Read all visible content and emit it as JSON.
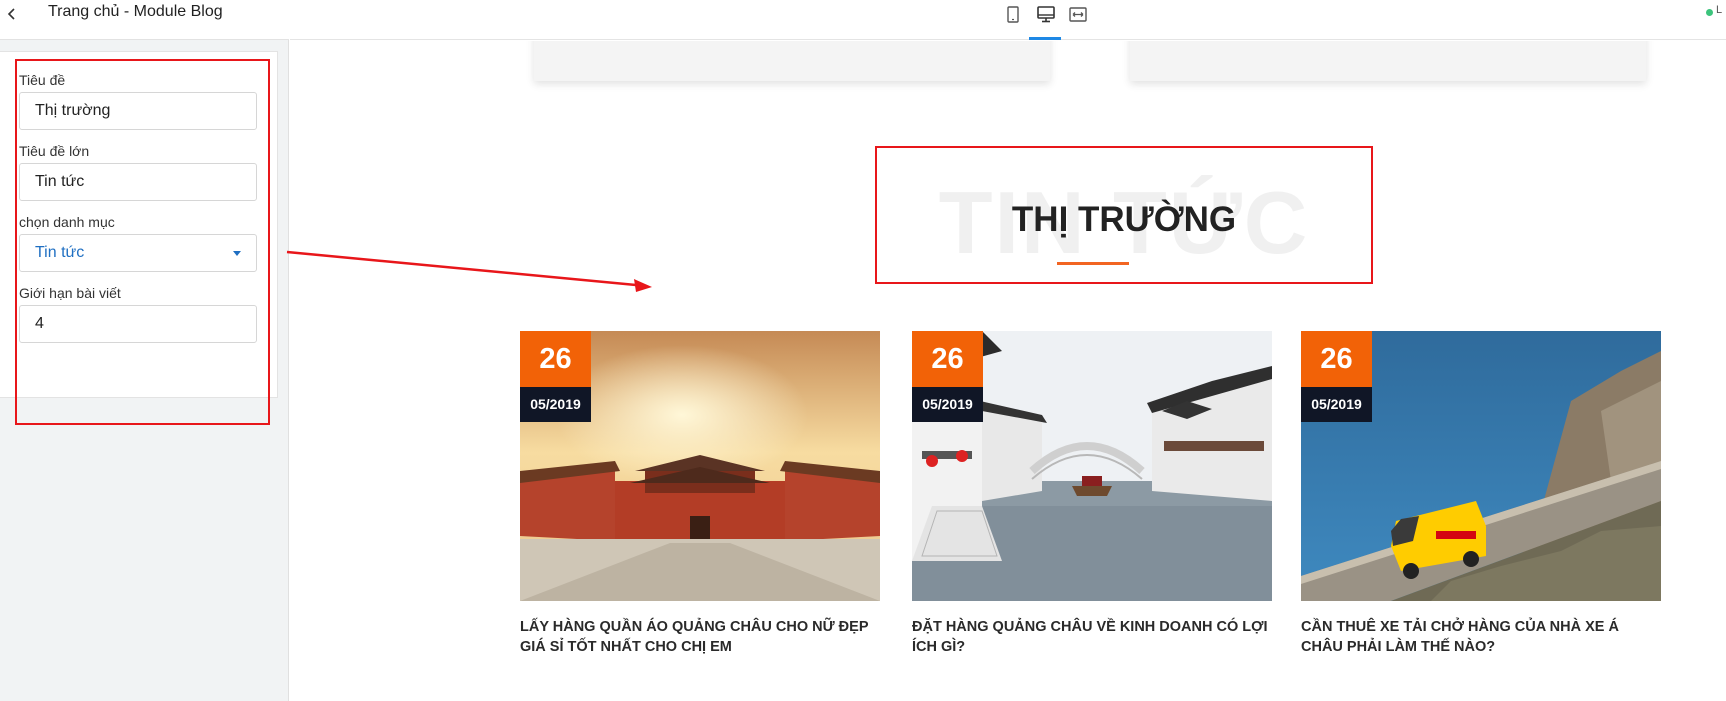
{
  "panel": {
    "title": "Trang chủ - Module Blog",
    "back_icon": "chevron-left-icon"
  },
  "form": {
    "fields": [
      {
        "label": "Tiêu đề",
        "value": "Thị trường"
      },
      {
        "label": "Tiêu đề lớn",
        "value": "Tin tức"
      },
      {
        "label": "chọn danh mục",
        "value": "Tin tức"
      },
      {
        "label": "Giới hạn bài viết",
        "value": "4"
      }
    ]
  },
  "toolbar": {
    "devices": [
      "tablet-icon",
      "desktop-icon",
      "fullwidth-icon"
    ],
    "active_device": "desktop-icon",
    "status_text": "L",
    "status_color": "#3cc47c"
  },
  "section": {
    "background_title": "TIN TỨC",
    "title": "THỊ TRƯỜNG",
    "accent_color": "#f26522"
  },
  "highlight_color": "#e8161a",
  "posts": [
    {
      "day": "26",
      "month": "05/2019",
      "title": "LẤY HÀNG QUẦN ÁO QUẢNG CHÂU CHO NỮ ĐẸP GIÁ SỈ TỐT NHẤT CHO CHỊ EM"
    },
    {
      "day": "26",
      "month": "05/2019",
      "title": "ĐẶT HÀNG QUẢNG CHÂU VỀ KINH DOANH CÓ LỢI ÍCH GÌ?"
    },
    {
      "day": "26",
      "month": "05/2019",
      "title": "CẦN THUÊ XE TẢI CHỞ HÀNG CỦA NHÀ XE Á CHÂU PHẢI LÀM THẾ NÀO?"
    }
  ]
}
